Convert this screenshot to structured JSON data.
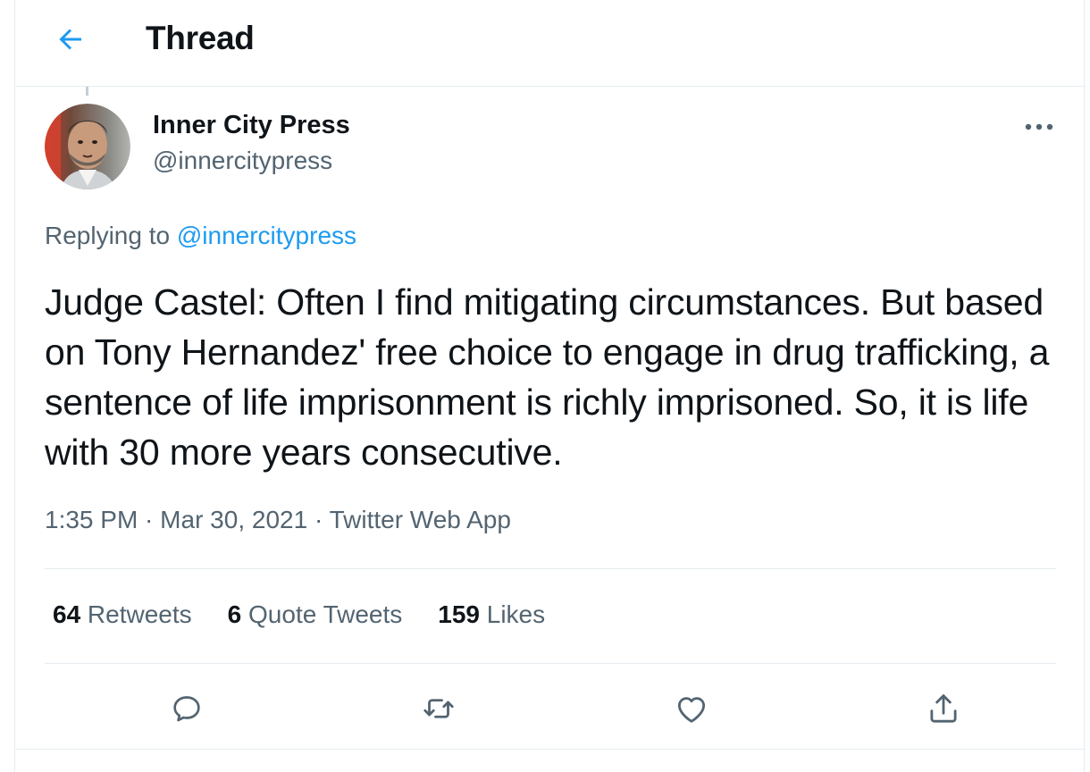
{
  "header": {
    "title": "Thread",
    "back_icon": "arrow-left-icon",
    "accent": "#1d9bf0"
  },
  "tweet": {
    "author": {
      "name": "Inner City Press",
      "handle": "@innercitypress"
    },
    "replying_prefix": "Replying to ",
    "replying_to": "@innercitypress",
    "text": "Judge Castel: Often I find mitigating circumstances. But based on Tony Hernandez' free choice to engage in drug trafficking, a sentence of life imprisonment is richly imprisoned. So, it is life with 30 more years consecutive.",
    "time": "1:35 PM",
    "date": "Mar 30, 2021",
    "separator": " · ",
    "source": "Twitter Web App"
  },
  "stats": [
    {
      "count": "64",
      "label": " Retweets"
    },
    {
      "count": "6",
      "label": " Quote Tweets"
    },
    {
      "count": "159",
      "label": " Likes"
    }
  ],
  "actions": [
    {
      "icon": "reply-icon"
    },
    {
      "icon": "retweet-icon"
    },
    {
      "icon": "like-icon"
    },
    {
      "icon": "share-icon"
    }
  ],
  "colors": {
    "text_primary": "#0f1419",
    "text_secondary": "#536471",
    "link": "#1d9bf0",
    "border": "#e6ecf0"
  }
}
